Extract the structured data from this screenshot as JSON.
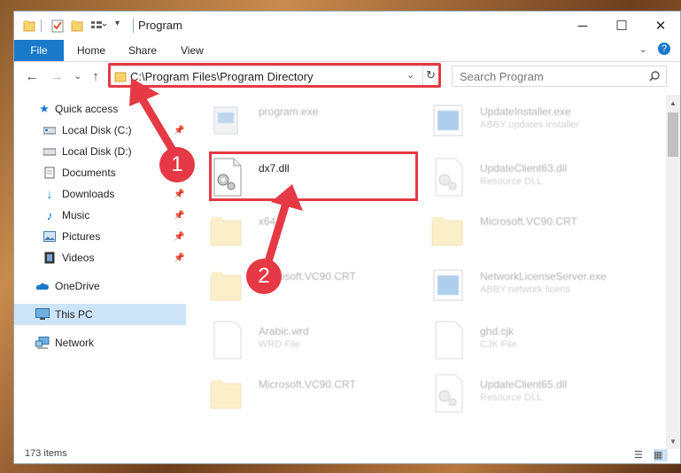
{
  "window": {
    "title": "Program",
    "controls": {
      "minimize": "─",
      "maximize": "☐",
      "close": "✕"
    }
  },
  "ribbon": {
    "file": "File",
    "tabs": [
      "Home",
      "Share",
      "View"
    ],
    "help_icon": "?"
  },
  "nav": {
    "address": "C:\\Program Files\\Program Directory",
    "search_placeholder": "Search Program"
  },
  "sidebar": {
    "items": [
      {
        "label": "Quick access",
        "icon": "star-icon",
        "pinned": false
      },
      {
        "label": "Local Disk (C:)",
        "icon": "drive-icon",
        "pinned": true
      },
      {
        "label": "Local Disk (D:)",
        "icon": "drive-icon",
        "pinned": false
      },
      {
        "label": "Documents",
        "icon": "documents-icon",
        "pinned": true
      },
      {
        "label": "Downloads",
        "icon": "download-icon",
        "pinned": true
      },
      {
        "label": "Music",
        "icon": "music-icon",
        "pinned": true
      },
      {
        "label": "Pictures",
        "icon": "pictures-icon",
        "pinned": true
      },
      {
        "label": "Videos",
        "icon": "videos-icon",
        "pinned": true
      },
      {
        "label": "OneDrive",
        "icon": "cloud-icon",
        "pinned": false
      },
      {
        "label": "This PC",
        "icon": "pc-icon",
        "pinned": false
      },
      {
        "label": "Network",
        "icon": "network-icon",
        "pinned": false
      }
    ]
  },
  "files": [
    {
      "name": "program.exe",
      "desc": "",
      "type": "exe"
    },
    {
      "name": "UpdateInstaller.exe",
      "desc": "ABBY updates installer",
      "type": "exe-blue"
    },
    {
      "name": "dx7.dll",
      "desc": "",
      "type": "dll"
    },
    {
      "name": "UpdateClient63.dll",
      "desc": "Resource DLL",
      "type": "dll"
    },
    {
      "name": "x64",
      "desc": "",
      "type": "folder"
    },
    {
      "name": "Microsoft.VC90.CRT",
      "desc": "",
      "type": "folder"
    },
    {
      "name": "Microsoft.VC90.CRT",
      "desc": "",
      "type": "folder"
    },
    {
      "name": "NetworkLicenseServer.exe",
      "desc": "ABBY network licens",
      "type": "exe-blue"
    },
    {
      "name": "Arabic.wrd",
      "desc": "WRD File",
      "type": "file"
    },
    {
      "name": "ghd.cjk",
      "desc": "CJK File",
      "type": "file"
    },
    {
      "name": "Microsoft.VC90.CRT",
      "desc": "",
      "type": "folder"
    },
    {
      "name": "UpdateClient65.dll",
      "desc": "Resource DLL",
      "type": "dll"
    }
  ],
  "status": {
    "items": "173 items"
  },
  "annotations": {
    "step1": "1",
    "step2": "2"
  },
  "colors": {
    "accent": "#1979ca",
    "annotation": "#e53945",
    "selected": "#cce4f7"
  }
}
